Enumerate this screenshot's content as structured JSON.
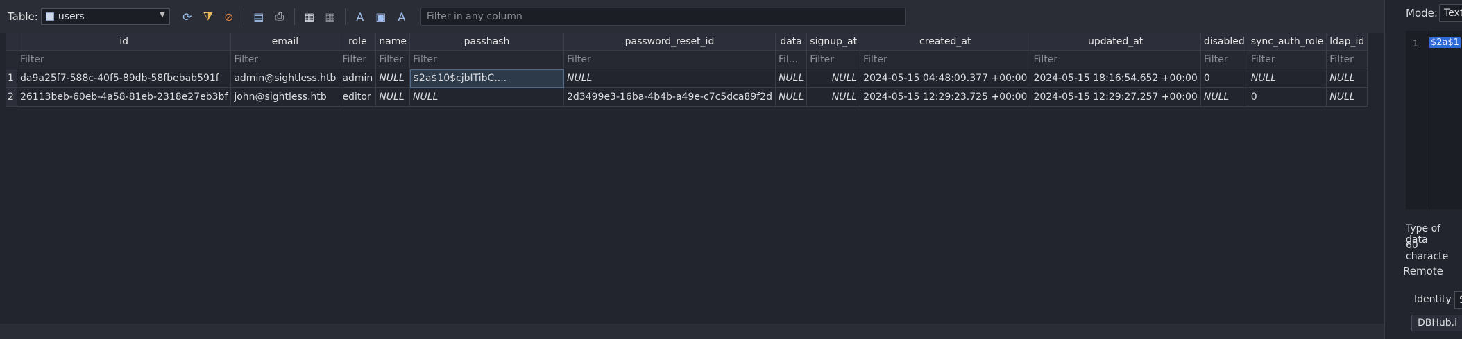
{
  "toolbar": {
    "table_label": "Table:",
    "table_name": "users",
    "filter_placeholder": "Filter in any column",
    "icons": [
      "refresh-icon",
      "clear-filters-icon",
      "save-filter-icon",
      "export-icon",
      "print-icon",
      "insert-record-icon",
      "delete-record-icon",
      "find-icon",
      "find-replace-icon",
      "format-icon"
    ]
  },
  "grid": {
    "columns": [
      "id",
      "email",
      "role",
      "name",
      "passhash",
      "password_reset_id",
      "data",
      "signup_at",
      "created_at",
      "updated_at",
      "disabled",
      "sync_auth_role",
      "ldap_id"
    ],
    "filters": [
      "Filter",
      "Filter",
      "Filter",
      "Filter",
      "Filter",
      "Filter",
      "Fil...",
      "Filter",
      "Filter",
      "Filter",
      "Filter",
      "Filter",
      "Filter"
    ],
    "rows": [
      {
        "num": "1",
        "cells": [
          "da9a25f7-588c-40f5-89db-58fbebab591f",
          "admin@sightless.htb",
          "admin",
          "NULL",
          "$2a$10$cjbITibC....",
          "NULL",
          "NULL",
          "NULL",
          "2024-05-15 04:48:09.377 +00:00",
          "2024-05-15 18:16:54.652 +00:00",
          "0",
          "NULL",
          "NULL"
        ]
      },
      {
        "num": "2",
        "cells": [
          "26113beb-60eb-4a58-81eb-2318e27eb3bf",
          "john@sightless.htb",
          "editor",
          "NULL",
          "NULL",
          "2d3499e3-16ba-4b4b-a49e-c7c5dca89f2d",
          "NULL",
          "NULL",
          "2024-05-15 12:29:23.725 +00:00",
          "2024-05-15 12:29:27.257 +00:00",
          "NULL",
          "0",
          "NULL"
        ]
      }
    ]
  },
  "right_panel": {
    "mode_label": "Mode:",
    "mode_value": "Text",
    "line_number": "1",
    "editor_selected": "$2a$1",
    "type_of_data": "Type of data",
    "char_count": "60 characte",
    "remote_label": "Remote",
    "identity_label": "Identity",
    "identity_value": "S",
    "dbhub_label": "DBHub.i"
  },
  "colors": {
    "background": "#22252e",
    "header": "#2c2f39",
    "selection": "#2f6bd6",
    "null_text": "#8a8d96"
  }
}
